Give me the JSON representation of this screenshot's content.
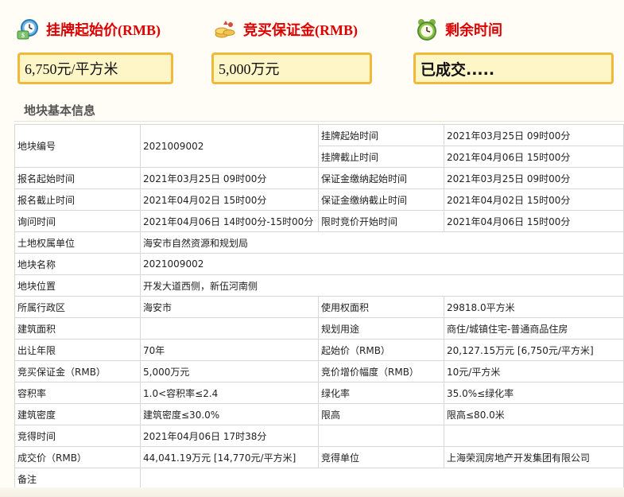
{
  "header": {
    "start_price": {
      "label": "挂牌起始价(RMB)",
      "value": "6,750元/平方米"
    },
    "deposit": {
      "label": "竞买保证金(RMB)",
      "value": "5,000万元"
    },
    "remaining": {
      "label": "剩余时间",
      "value": "已成交....."
    }
  },
  "section_title": "地块基本信息",
  "table": {
    "r1": {
      "l1": "地块编号",
      "v1": "2021009002",
      "l2a": "挂牌起始时间",
      "v2a": "2021年03月25日 09时00分",
      "l2b": "挂牌截止时间",
      "v2b": "2021年04月06日 15时00分"
    },
    "r2": {
      "l1": "报名起始时间",
      "v1": "2021年03月25日 09时00分",
      "l2": "保证金缴纳起始时间",
      "v2": "2021年03月25日 09时00分"
    },
    "r3": {
      "l1": "报名截止时间",
      "v1": "2021年04月02日 15时00分",
      "l2": "保证金缴纳截止时间",
      "v2": "2021年04月02日 15时00分"
    },
    "r4": {
      "l1": "询问时间",
      "v1": "2021年04月06日 14时00分-15时00分",
      "l2": "限时竞价开始时间",
      "v2": "2021年04月06日 15时00分"
    },
    "r5": {
      "l1": "土地权属单位",
      "v1": "海安市自然资源和规划局"
    },
    "r6": {
      "l1": "地块名称",
      "v1": "2021009002"
    },
    "r7": {
      "l1": "地块位置",
      "v1": "开发大道西侧，新伍河南侧"
    },
    "r8": {
      "l1": "所属行政区",
      "v1": "海安市",
      "l2": "使用权面积",
      "v2": "29818.0平方米"
    },
    "r9": {
      "l1": "建筑面积",
      "v1": "",
      "l2": "规划用途",
      "v2": "商住/城镇住宅-普通商品住房"
    },
    "r10": {
      "l1": "出让年限",
      "v1": "70年",
      "l2": "起始价（RMB）",
      "v2": "20,127.15万元 [6,750元/平方米]"
    },
    "r11": {
      "l1": "竞买保证金（RMB）",
      "v1": "5,000万元",
      "l2": "竞价增价幅度（RMB）",
      "v2": "10元/平方米"
    },
    "r12": {
      "l1": "容积率",
      "v1": "1.0<容积率≤2.4",
      "l2": "绿化率",
      "v2": "35.0%≤绿化率"
    },
    "r13": {
      "l1": "建筑密度",
      "v1": "建筑密度≤30.0%",
      "l2": "限高",
      "v2": "限高≤80.0米"
    },
    "r14": {
      "l1": "竞得时间",
      "v1": "2021年04月06日 17时38分",
      "l2": "",
      "v2": ""
    },
    "r15": {
      "l1": "成交价（RMB）",
      "v1": "44,041.19万元 [14,770元/平方米]",
      "l2": "竞得单位",
      "v2": "上海荣润房地产开发集团有限公司"
    },
    "r16": {
      "l1": "备注",
      "v1": ""
    }
  },
  "icons": {
    "start_price": "money-clock-icon",
    "deposit": "coins-icon",
    "remaining": "alarm-clock-icon"
  }
}
